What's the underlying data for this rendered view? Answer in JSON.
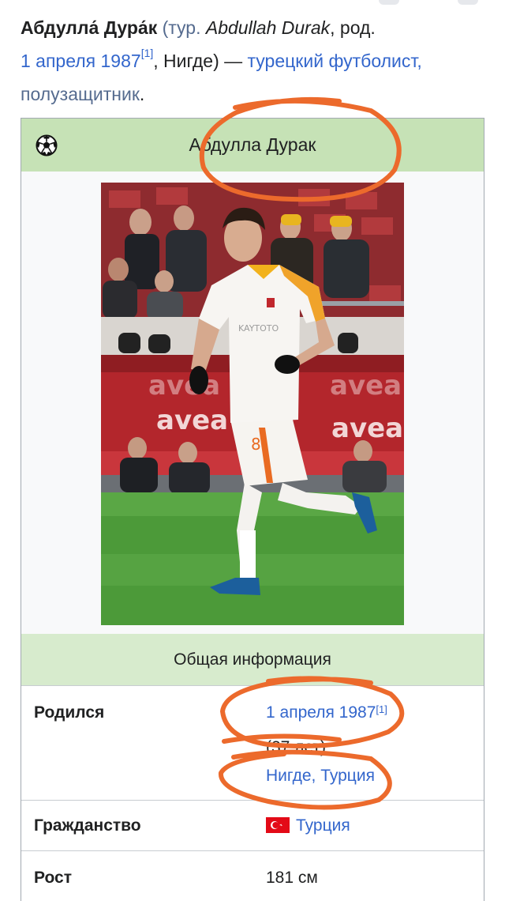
{
  "lead": {
    "name": "Абдулла́ Дура́к",
    "open_paren": " (тур. ",
    "original_name": "Abdullah Durak",
    "born_word": ", род.",
    "birth_date_link": "1 апреля 1987",
    "ref": "[1]",
    "birth_place": ", Нигде) — ",
    "profession_link": "турецкий футболист,",
    "position_link": "полузащитник",
    "period": "."
  },
  "infobox": {
    "title": "Абдулла Дурак",
    "header_icon": "football-icon",
    "section_general": "Общая информация",
    "rows": [
      {
        "label": "Родился",
        "date": "1 апреля 1987",
        "ref": "[1]",
        "age": "(37 лет)",
        "place": "Нигде, Турция"
      },
      {
        "label": "Гражданство",
        "flag_icon": "turkey-flag-icon",
        "value": "Турция"
      },
      {
        "label": "Рост",
        "value": "181 см"
      }
    ]
  },
  "photo": {
    "jersey_number": "8",
    "sponsor": "avea",
    "shirt_text": "KAYTOTO"
  },
  "colors": {
    "header_green": "#c6e2b6",
    "section_green": "#d7ebcd",
    "link_blue": "#3366cc",
    "annotation_orange": "#ec6a2c"
  }
}
